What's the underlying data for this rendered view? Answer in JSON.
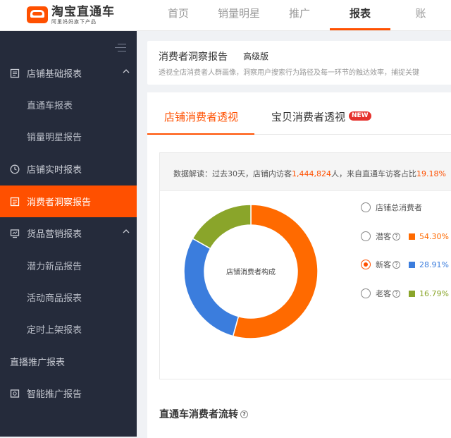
{
  "app": {
    "logo_title": "淘宝直通车",
    "logo_subtitle": "阿里妈妈旗下产品"
  },
  "nav": {
    "items": [
      {
        "label": "首页",
        "active": false
      },
      {
        "label": "销量明星",
        "active": false
      },
      {
        "label": "推广",
        "active": false
      },
      {
        "label": "报表",
        "active": true
      },
      {
        "label": "账",
        "active": false
      }
    ]
  },
  "sidebar": {
    "items": [
      {
        "label": "店铺基础报表",
        "type": "group",
        "expanded": true
      },
      {
        "label": "直通车报表",
        "type": "sub"
      },
      {
        "label": "销量明星报告",
        "type": "sub"
      },
      {
        "label": "店铺实时报表",
        "type": "group"
      },
      {
        "label": "消费者洞察报告",
        "type": "group",
        "active": true
      },
      {
        "label": "货品营销报表",
        "type": "group",
        "expanded": true
      },
      {
        "label": "潜力新品报告",
        "type": "sub"
      },
      {
        "label": "活动商品报表",
        "type": "sub"
      },
      {
        "label": "定时上架报表",
        "type": "sub"
      },
      {
        "label": "直播推广报表",
        "type": "flat"
      },
      {
        "label": "智能推广报告",
        "type": "group"
      }
    ]
  },
  "header": {
    "title": "消费者洞察报告",
    "badge": "高级版",
    "description": "透视全店消费者人群画像，洞察用户搜索行为路径及每一环节的触达效率，捕捉关键"
  },
  "tabs": [
    {
      "label": "店铺消费者透视",
      "active": true
    },
    {
      "label": "宝贝消费者透视",
      "active": false,
      "badge": "NEW"
    }
  ],
  "insight": {
    "prefix": "数据解读：过去30天，店铺内访客",
    "visitors": "1,444,824",
    "middle": "人，来自直通车访客占比",
    "share": "19.18%"
  },
  "chart_data": {
    "type": "pie",
    "center_label": "店铺消费者构成",
    "categories": [
      "潜客",
      "新客",
      "老客"
    ],
    "values": [
      54.3,
      28.91,
      16.79
    ],
    "colors": [
      "#ff6a00",
      "#3b7ddd",
      "#8aa52a"
    ]
  },
  "legend": {
    "total_label": "店铺总消费者",
    "items": [
      {
        "label": "潜客",
        "value": "54.30%",
        "color": "#ff6a00",
        "checked": false
      },
      {
        "label": "新客",
        "value": "28.91%",
        "color": "#3b7ddd",
        "checked": true
      },
      {
        "label": "老客",
        "value": "16.79%",
        "color": "#8aa52a",
        "checked": false
      }
    ],
    "help_glyph": "?"
  },
  "section": {
    "title": "直通车消费者流转"
  }
}
